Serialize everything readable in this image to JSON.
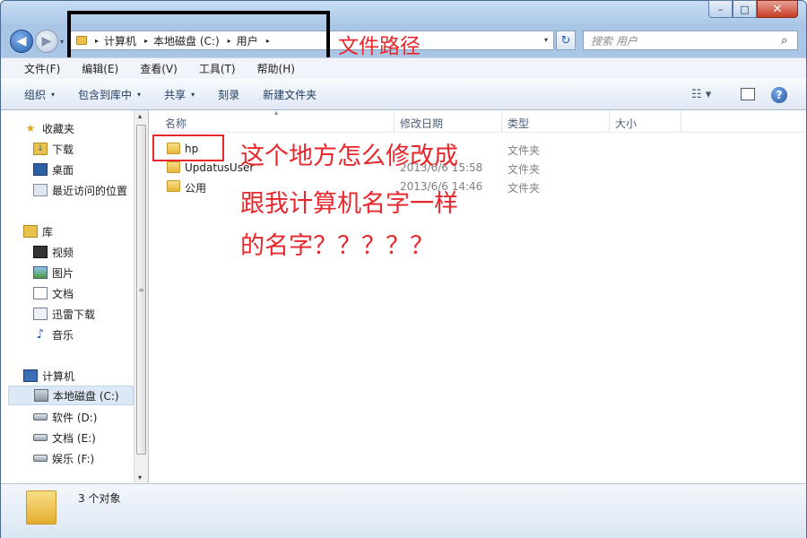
{
  "window": {
    "min_label": "–",
    "max_label": "□",
    "close_label": "✕"
  },
  "nav": {
    "back_label": "◀",
    "forward_label": "▶",
    "history_caret": "▾"
  },
  "address": {
    "crumbs": [
      "计算机",
      "本地磁盘 (C:)",
      "用户"
    ],
    "separator": "▸",
    "dropdown": "▾",
    "refresh_label": "↻"
  },
  "search": {
    "placeholder": "搜索 用户",
    "icon": "magnifier-icon",
    "icon_glyph": "⌕"
  },
  "annotations": {
    "path_label": "文件路径",
    "question_lines": [
      "这个地方怎么修改成",
      "跟我计算机名字一样",
      "的名字？？？？？"
    ],
    "highlight_color": "#e8262b"
  },
  "menubar": {
    "items": [
      "文件(F)",
      "编辑(E)",
      "查看(V)",
      "工具(T)",
      "帮助(H)"
    ]
  },
  "commandbar": {
    "organize": "组织",
    "include_library": "包含到库中",
    "share": "共享",
    "burn": "刻录",
    "new_folder": "新建文件夹",
    "caret": "▾",
    "view_icon_glyph": "☷",
    "help_label": "?"
  },
  "sidebar": {
    "favorites": {
      "label": "收藏夹",
      "items": [
        {
          "label": "下载",
          "icon": "download-folder-icon"
        },
        {
          "label": "桌面",
          "icon": "desktop-icon"
        },
        {
          "label": "最近访问的位置",
          "icon": "recent-places-icon"
        }
      ]
    },
    "libraries": {
      "label": "库",
      "items": [
        {
          "label": "视频",
          "icon": "video-library-icon"
        },
        {
          "label": "图片",
          "icon": "picture-library-icon"
        },
        {
          "label": "文档",
          "icon": "document-library-icon"
        },
        {
          "label": "迅雷下载",
          "icon": "download-library-icon"
        },
        {
          "label": "音乐",
          "icon": "music-library-icon"
        }
      ]
    },
    "computer": {
      "label": "计算机",
      "items": [
        {
          "label": "本地磁盘 (C:)",
          "icon": "system-drive-icon",
          "selected": true
        },
        {
          "label": "软件 (D:)",
          "icon": "drive-icon"
        },
        {
          "label": "文档 (E:)",
          "icon": "drive-icon"
        },
        {
          "label": "娱乐 (F:)",
          "icon": "drive-icon"
        }
      ]
    },
    "scroll": {
      "up": "▴",
      "down": "▾",
      "grip": "≡"
    }
  },
  "filelist": {
    "columns": [
      "名称",
      "修改日期",
      "类型",
      "大小"
    ],
    "sort_indicator": "▴",
    "rows": [
      {
        "name": "hp",
        "date": "",
        "type": "文件夹"
      },
      {
        "name": "UpdatusUser",
        "date": "2013/6/6 15:58",
        "type": "文件夹"
      },
      {
        "name": "公用",
        "date": "2013/6/6 14:46",
        "type": "文件夹"
      }
    ]
  },
  "details": {
    "status": "3 个对象"
  }
}
